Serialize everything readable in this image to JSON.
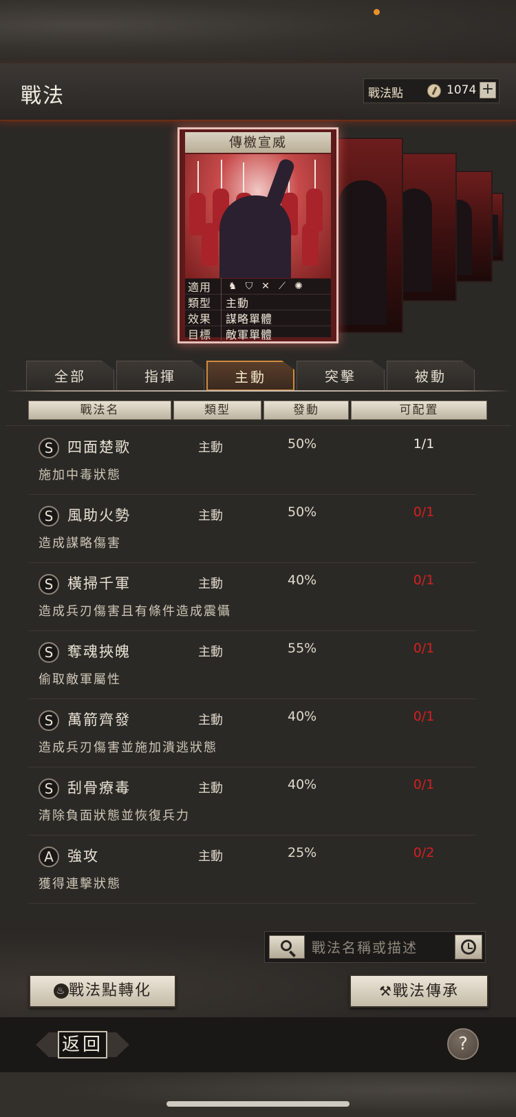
{
  "header": {
    "title": "戰法",
    "points_label": "戰法點",
    "points_value": "1074",
    "plus": "+"
  },
  "card": {
    "title": "傳檄宣威",
    "rows": [
      {
        "key": "適用",
        "value": ""
      },
      {
        "key": "類型",
        "value": "主動"
      },
      {
        "key": "效果",
        "value": "謀略單體"
      },
      {
        "key": "目標",
        "value": "敵軍單體"
      }
    ],
    "applicable_icons": [
      "cavalry-icon",
      "shield-icon",
      "bow-icon",
      "spear-icon",
      "wheel-icon"
    ]
  },
  "tabs": [
    "全部",
    "指揮",
    "主動",
    "突擊",
    "被動"
  ],
  "active_tab": "主動",
  "columns": [
    "戰法名",
    "類型",
    "發動",
    "可配置"
  ],
  "tactics": [
    {
      "grade": "S",
      "name": "四面楚歌",
      "type": "主動",
      "rate": "50%",
      "slots": "1/1",
      "available": true,
      "desc": "施加中毒狀態"
    },
    {
      "grade": "S",
      "name": "風助火勢",
      "type": "主動",
      "rate": "50%",
      "slots": "0/1",
      "available": false,
      "desc": "造成謀略傷害"
    },
    {
      "grade": "S",
      "name": "橫掃千軍",
      "type": "主動",
      "rate": "40%",
      "slots": "0/1",
      "available": false,
      "desc": "造成兵刃傷害且有條件造成震懾"
    },
    {
      "grade": "S",
      "name": "奪魂挾魄",
      "type": "主動",
      "rate": "55%",
      "slots": "0/1",
      "available": false,
      "desc": "偷取敵軍屬性"
    },
    {
      "grade": "S",
      "name": "萬箭齊發",
      "type": "主動",
      "rate": "40%",
      "slots": "0/1",
      "available": false,
      "desc": "造成兵刃傷害並施加潰逃狀態"
    },
    {
      "grade": "S",
      "name": "刮骨療毒",
      "type": "主動",
      "rate": "40%",
      "slots": "0/1",
      "available": false,
      "desc": "清除負面狀態並恢復兵力"
    },
    {
      "grade": "A",
      "name": "強攻",
      "type": "主動",
      "rate": "25%",
      "slots": "0/2",
      "available": false,
      "desc": "獲得連擊狀態"
    }
  ],
  "search": {
    "placeholder": "戰法名稱或描述"
  },
  "buttons": {
    "convert": "戰法點轉化",
    "inherit": "戰法傳承",
    "back": "返回",
    "help": "?"
  },
  "colors": {
    "available": "#f0ece4",
    "unavailable": "#d42020",
    "accent": "#d28b3d"
  }
}
